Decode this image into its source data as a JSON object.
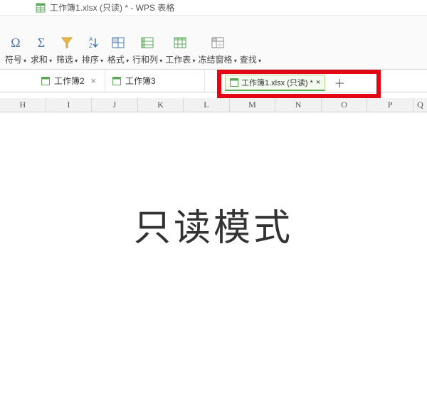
{
  "title": "工作簿1.xlsx (只读) * - WPS 表格",
  "ribbon": {
    "symbol": "符号",
    "sum": "求和",
    "filter": "筛选",
    "sort": "排序",
    "format": "格式",
    "rowcol": "行和列",
    "worksheet": "工作表",
    "freeze": "冻结窗格",
    "find": "查找"
  },
  "tabs": {
    "t1": "工作簿2",
    "t2": "工作簿3",
    "active": "工作簿1.xlsx (只读) *"
  },
  "columns": [
    "H",
    "I",
    "J",
    "K",
    "L",
    "M",
    "N",
    "O",
    "P",
    "Q"
  ],
  "main_text": "只读模式"
}
